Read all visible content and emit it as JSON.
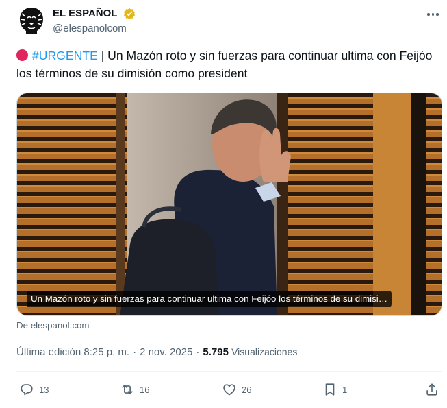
{
  "author": {
    "name": "EL ESPAÑOL",
    "handle": "@elespanolcom",
    "verified": true,
    "avatar_icon": "lion-logo-icon"
  },
  "post": {
    "hashtag": "#URGENTE",
    "text": " | Un Mazón roto y sin fuerzas para continuar ultima con Feijóo los términos de su dimisión como president",
    "alert_color": "#e0245e"
  },
  "card": {
    "caption": "Un Mazón roto y sin fuerzas para continuar ultima con Feijóo los términos de su dimisi…",
    "source": "De elespanol.com"
  },
  "meta": {
    "edited": "Última edición 8:25 p. m.",
    "separator": "·",
    "date": "2 nov. 2025",
    "views_count": "5.795",
    "views_label": "Visualizaciones"
  },
  "actions": {
    "replies": "13",
    "reposts": "16",
    "likes": "26",
    "bookmarks": "1"
  },
  "colors": {
    "link": "#1d9bf0",
    "secondary_text": "#536471",
    "primary_text": "#0f1419"
  }
}
